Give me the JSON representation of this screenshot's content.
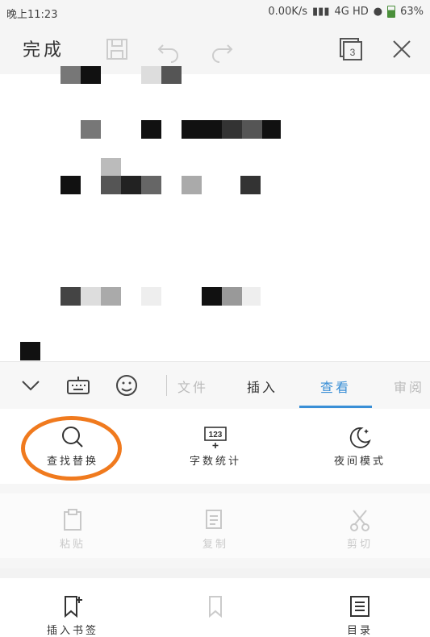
{
  "status_bar": {
    "time": "晚上11:23",
    "net_speed": "0.00K/s",
    "network": "4G HD",
    "battery": "63%"
  },
  "toolbar": {
    "done_label": "完成",
    "page_count": "3"
  },
  "tabs": [
    {
      "label": "文件",
      "state": "faded"
    },
    {
      "label": "插入",
      "state": "normal"
    },
    {
      "label": "查看",
      "state": "active"
    },
    {
      "label": "审阅",
      "state": "partial"
    }
  ],
  "view_tools": [
    {
      "label": "查找替换",
      "icon": "search-icon"
    },
    {
      "label": "字数统计",
      "icon": "word-count-icon",
      "icon_text": "123"
    },
    {
      "label": "夜间模式",
      "icon": "moon-icon"
    }
  ],
  "edit_tools": [
    {
      "label": "粘贴",
      "icon": "paste-icon"
    },
    {
      "label": "复制",
      "icon": "copy-icon"
    },
    {
      "label": "剪切",
      "icon": "cut-icon"
    }
  ],
  "nav_tools": [
    {
      "label": "插入书签",
      "icon": "bookmark-add-icon"
    },
    {
      "label": "",
      "icon": "bookmark-icon"
    },
    {
      "label": "目录",
      "icon": "toc-icon"
    }
  ],
  "colors": {
    "accent": "#3a8fd6",
    "highlight": "#f07a1e"
  }
}
